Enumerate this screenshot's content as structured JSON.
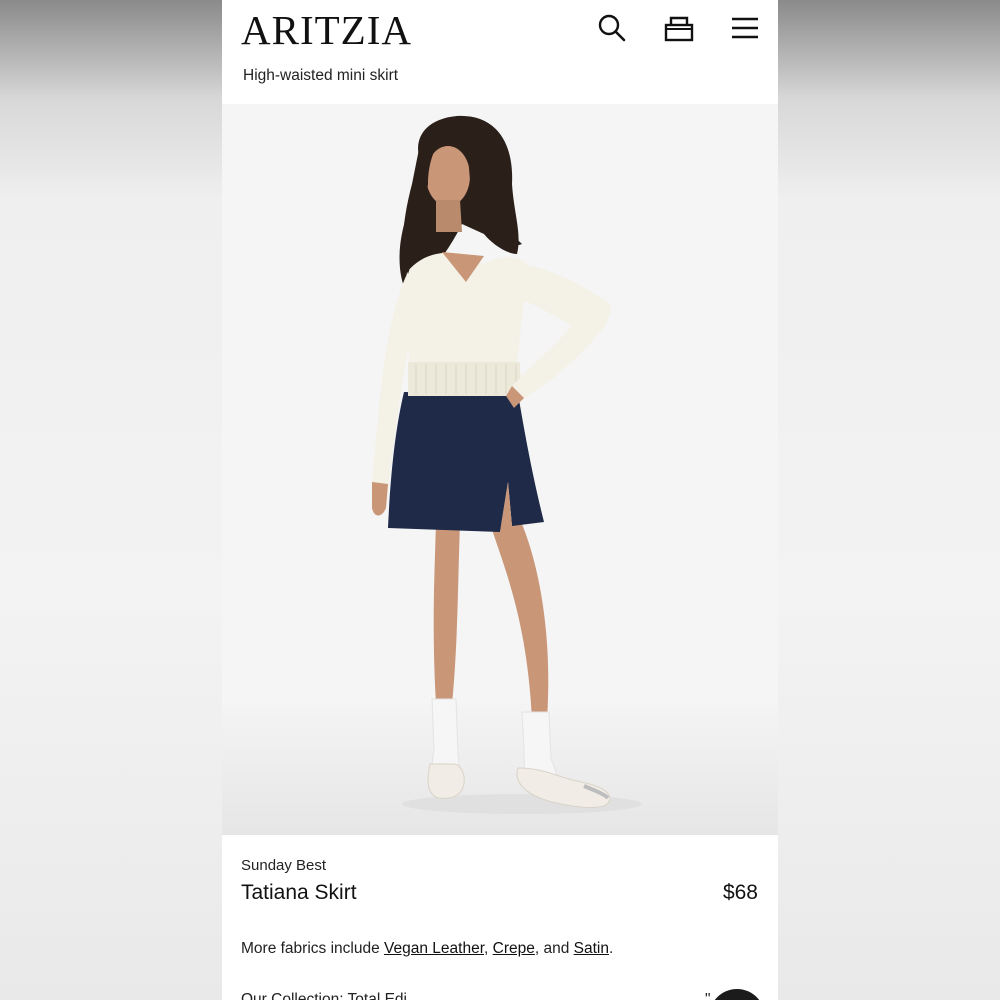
{
  "header": {
    "logo": "ARITZIA",
    "subtitle": "High-waisted mini skirt",
    "icons": [
      "search-icon",
      "bag-icon",
      "menu-icon"
    ]
  },
  "product": {
    "collection": "Sunday Best",
    "name": "Tatiana Skirt",
    "price": "$68"
  },
  "fabrics": {
    "prefix": "More fabrics include ",
    "links": [
      "Vegan Leather",
      "Crepe",
      "Satin"
    ],
    "sep1": ", ",
    "sep2": ", and ",
    "suffix": "."
  },
  "cutoff": {
    "left": "Our Collection: Total Edi",
    "right": "\""
  },
  "colors": {
    "skirt": "#1f2a48",
    "sweater": "#f4f1e6",
    "chat_bubble": "#1b1b1b"
  }
}
